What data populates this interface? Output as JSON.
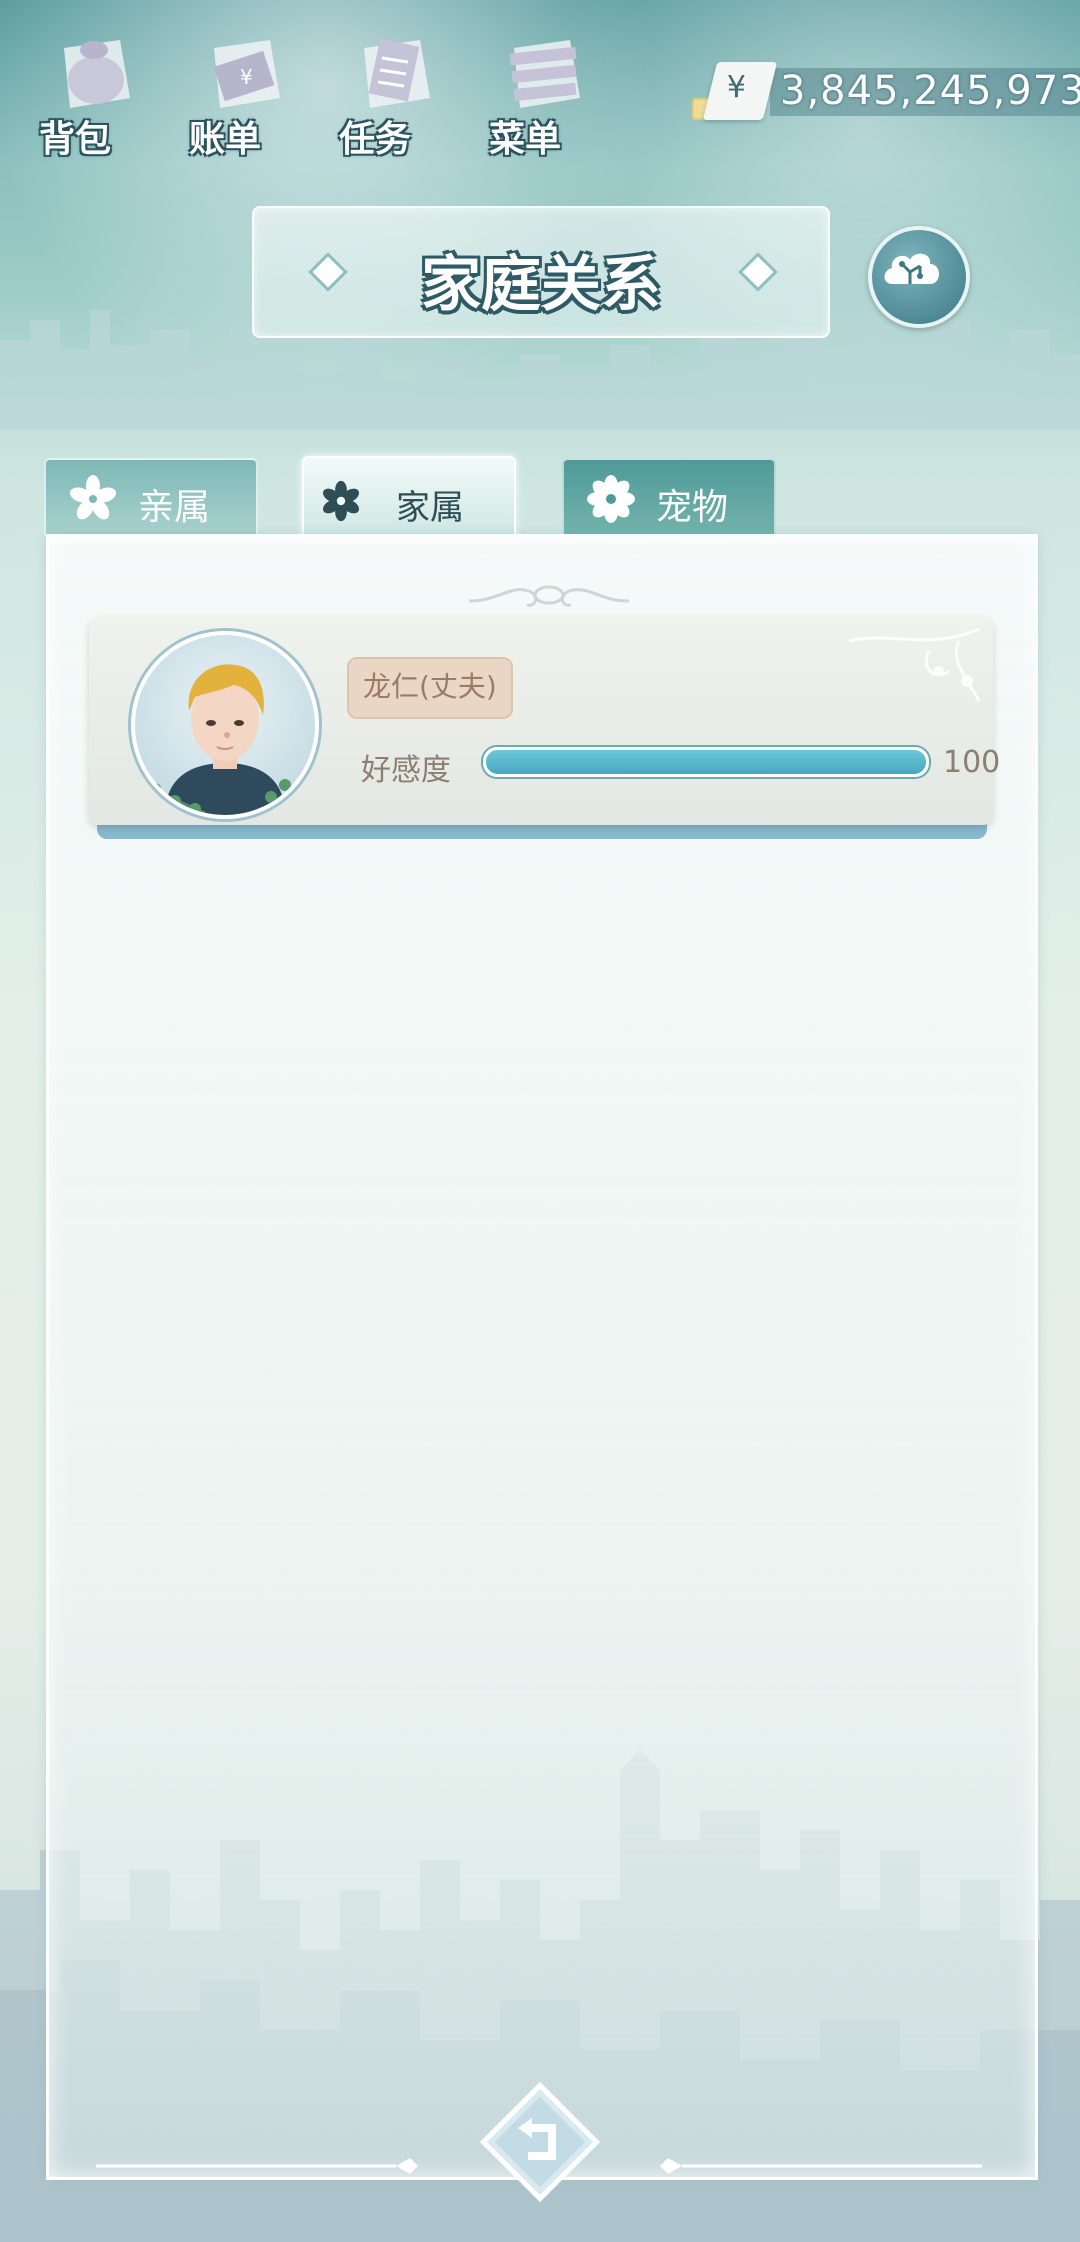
{
  "top_nav": {
    "items": [
      {
        "label": "背包",
        "icon": "backpack-icon"
      },
      {
        "label": "账单",
        "icon": "bill-icon"
      },
      {
        "label": "任务",
        "icon": "task-icon"
      },
      {
        "label": "菜单",
        "icon": "menu-icon"
      }
    ]
  },
  "currency": {
    "symbol": "¥",
    "amount": "3,845,245,973"
  },
  "header": {
    "title": "家庭关系"
  },
  "tabs": [
    {
      "label": "亲属",
      "state": "inactive"
    },
    {
      "label": "家属",
      "state": "active"
    },
    {
      "label": "宠物",
      "state": "inactive"
    }
  ],
  "member": {
    "name": "龙仁(丈夫)",
    "affection_label": "好感度",
    "affection_value": "100",
    "affection_fraction": 1.0
  },
  "colors": {
    "accent": "#48a8c0",
    "title_outline": "#2f5b66",
    "name_tag": "#ead6c4"
  }
}
